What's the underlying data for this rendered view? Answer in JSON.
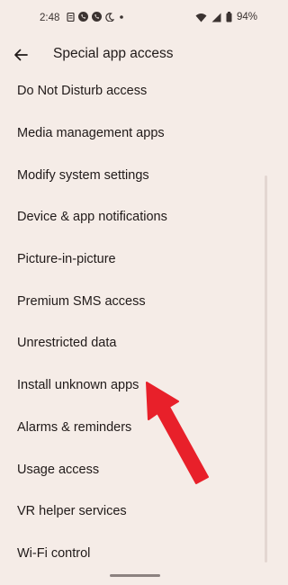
{
  "status_bar": {
    "time": "2:48",
    "battery": "94%",
    "icons_left": [
      "notes-icon",
      "phone-icon",
      "phone-icon",
      "moon-icon",
      "dot-icon"
    ],
    "icons_right": [
      "wifi-icon",
      "signal-icon",
      "battery-icon"
    ]
  },
  "header": {
    "title": "Special app access"
  },
  "list": {
    "items": [
      {
        "label": "Do Not Disturb access"
      },
      {
        "label": "Media management apps"
      },
      {
        "label": "Modify system settings"
      },
      {
        "label": "Device & app notifications"
      },
      {
        "label": "Picture-in-picture"
      },
      {
        "label": "Premium SMS access"
      },
      {
        "label": "Unrestricted data"
      },
      {
        "label": "Install unknown apps"
      },
      {
        "label": "Alarms & reminders"
      },
      {
        "label": "Usage access"
      },
      {
        "label": "VR helper services"
      },
      {
        "label": "Wi-Fi control"
      }
    ]
  },
  "colors": {
    "background": "#f5ece7",
    "text": "#201a19",
    "annotation_arrow": "#e8202a"
  }
}
